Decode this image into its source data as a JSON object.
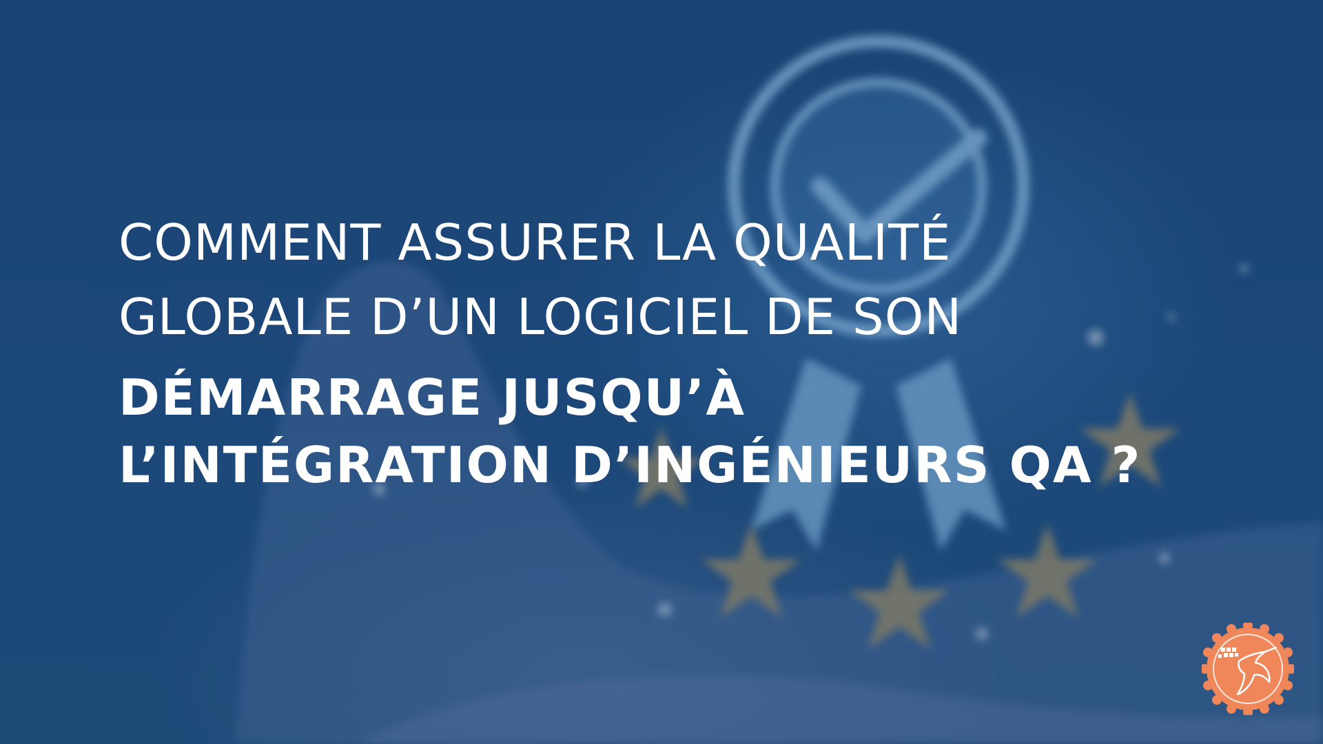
{
  "headline": {
    "line1": "COMMENT ASSURER LA QUALITÉ",
    "line2": "GLOBALE D’UN LOGICIEL DE SON",
    "line3": "DÉMARRAGE JUSQU’À",
    "line4": "L’INTÉGRATION D’INGÉNIEURS QA ?"
  },
  "colors": {
    "background": "#1e4d7e",
    "text": "#ffffff",
    "badge": "#8fc3ea",
    "stars": "#b39a63",
    "logo": "#f0875a"
  },
  "icons": {
    "background_badge": "award-ribbon-checkmark-icon",
    "stars": "star-icon",
    "logo": "hummingbird-logo-icon"
  }
}
